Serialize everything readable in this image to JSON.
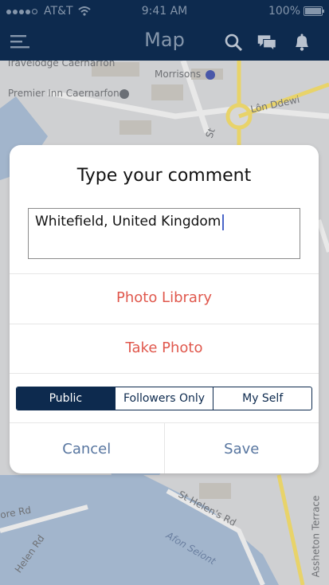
{
  "status_bar": {
    "carrier": "AT&T",
    "time": "9:41 AM",
    "battery": "100%"
  },
  "nav": {
    "title": "Map"
  },
  "map": {
    "labels": {
      "travelodge": "Travelodge Caernarfon",
      "premier": "Premier Inn Caernarfon",
      "morrisons": "Morrisons",
      "lon_ddewi": "Lôn Ddewi",
      "st_helens": "St Helen's Rd",
      "afon": "Afon Seiont",
      "ore_rd": "ore Rd",
      "helen_rd": "Helen Rd",
      "assheton": "Assheton Terrace",
      "st_small": "St"
    }
  },
  "modal": {
    "title": "Type your comment",
    "comment_value": "Whitefield, United Kingdom",
    "photo_library": "Photo Library",
    "take_photo": "Take Photo",
    "visibility": {
      "options": [
        "Public",
        "Followers Only",
        "My Self"
      ],
      "selected": "Public"
    },
    "cancel": "Cancel",
    "save": "Save"
  },
  "colors": {
    "nav_bg": "#0d2a4e",
    "accent_red": "#e0584d",
    "button_blue": "#5876a0"
  }
}
